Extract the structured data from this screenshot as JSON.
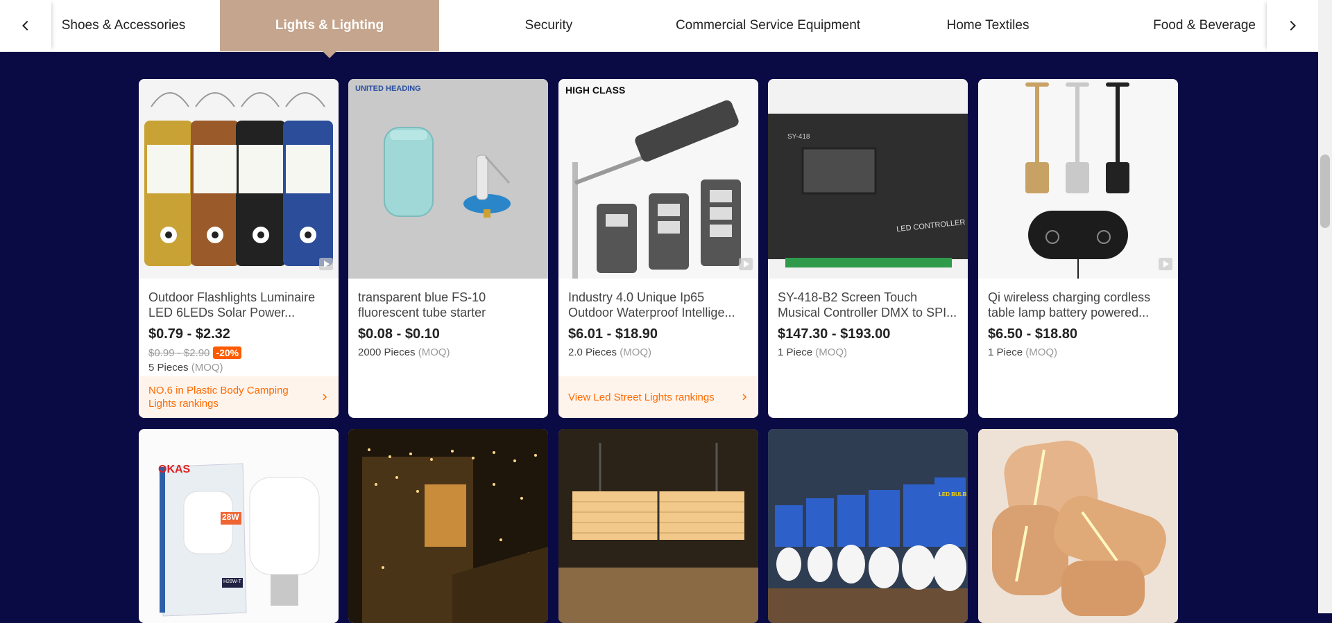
{
  "categories": {
    "prev_icon": "chevron-left-icon",
    "next_icon": "chevron-right-icon",
    "items": [
      {
        "label": "Shoes & Accessories",
        "active": false
      },
      {
        "label": "Lights & Lighting",
        "active": true
      },
      {
        "label": "Security",
        "active": false
      },
      {
        "label": "Commercial Service Equipment",
        "active": false
      },
      {
        "label": "Home Textiles",
        "active": false
      },
      {
        "label": "Food & Beverage",
        "active": false
      }
    ],
    "accent": "#c5a58d"
  },
  "colors": {
    "background": "#0a0a45",
    "discount": "#ff5a00",
    "ranking_text": "#ff6a00"
  },
  "products": [
    {
      "title": "Outdoor Flashlights Luminaire LED 6LEDs Solar Power...",
      "price": "$0.79 - $2.32",
      "original_price": "$0.99 - $2.90",
      "discount": "-20%",
      "moq_value": "5 Pieces",
      "moq_label": "(MOQ)",
      "ranking": "NO.6 in Plastic Body Camping Lights rankings",
      "video": true
    },
    {
      "title": "transparent blue FS-10 fluorescent tube starter",
      "price": "$0.08 - $0.10",
      "moq_value": "2000 Pieces",
      "moq_label": "(MOQ)",
      "brand": "UNITED HEADING",
      "video": false
    },
    {
      "title": "Industry 4.0 Unique Ip65 Outdoor Waterproof Intellige...",
      "price": "$6.01 - $18.90",
      "moq_value": "2.0 Pieces",
      "moq_label": "(MOQ)",
      "ranking": "View Led Street Lights rankings",
      "brand": "HIGH CLASS",
      "video": true
    },
    {
      "title": "SY-418-B2 Screen Touch Musical Controller DMX to SPI...",
      "price": "$147.30 - $193.00",
      "moq_value": "1 Piece",
      "moq_label": "(MOQ)",
      "device_text": "LED CONTROLLER",
      "device_model": "SY-418",
      "video": false
    },
    {
      "title": "Qi wireless charging cordless table lamp battery powered...",
      "price": "$6.50 - $18.80",
      "moq_value": "1 Piece",
      "moq_label": "(MOQ)",
      "video": true
    }
  ],
  "second_row": {
    "items": [
      {
        "image": "led-bulb-box",
        "box_brand": "OKAS",
        "box_text": "28W",
        "box_model": "H28W-T"
      },
      {
        "image": "string-lights-house"
      },
      {
        "image": "grow-light-panel"
      },
      {
        "image": "led-bulbs-row",
        "box_text": "LED BULB"
      },
      {
        "image": "wooden-lamp-bases"
      }
    ]
  }
}
